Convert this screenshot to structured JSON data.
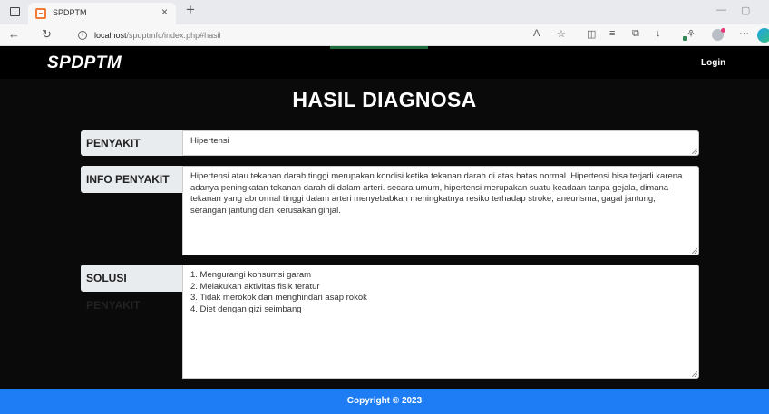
{
  "browser": {
    "tab_title": "SPDPTM",
    "tab_close": "×",
    "new_tab": "+",
    "url_host": "localhost",
    "url_path": "/spdptmfc/index.php#hasil",
    "info_glyph": "i",
    "window_minimize": "—",
    "window_restore": "▢"
  },
  "navbar": {
    "brand": "SPDPTM",
    "login": "Login"
  },
  "page": {
    "title": "HASIL DIAGNOSA"
  },
  "fields": {
    "penyakit_label": "PENYAKIT",
    "penyakit_value": "Hipertensi",
    "info_label": "INFO PENYAKIT",
    "info_value": "Hipertensi atau tekanan darah tinggi merupakan kondisi ketika tekanan darah di atas batas normal. Hipertensi bisa terjadi karena adanya peningkatan tekanan darah di dalam arteri. secara umum, hipertensi merupakan suatu keadaan tanpa gejala, dimana tekanan yang abnormal tinggi dalam arteri menyebabkan meningkatnya resiko terhadap stroke, aneurisma, gagal jantung, serangan jantung dan kerusakan ginjal.",
    "solusi_label": "SOLUSI PENYAKIT",
    "solusi_items": [
      "1. Mengurangi konsumsi garam",
      "2. Melakukan aktivitas fisik teratur",
      "3. Tidak merokok dan menghindari asap rokok",
      "4. Diet dengan gizi seimbang"
    ]
  },
  "footer": {
    "copyright": "Copyright © 2023"
  },
  "colors": {
    "footer_bg": "#1e7cf5",
    "page_bg": "#000000",
    "label_bg": "#e9ecef"
  }
}
